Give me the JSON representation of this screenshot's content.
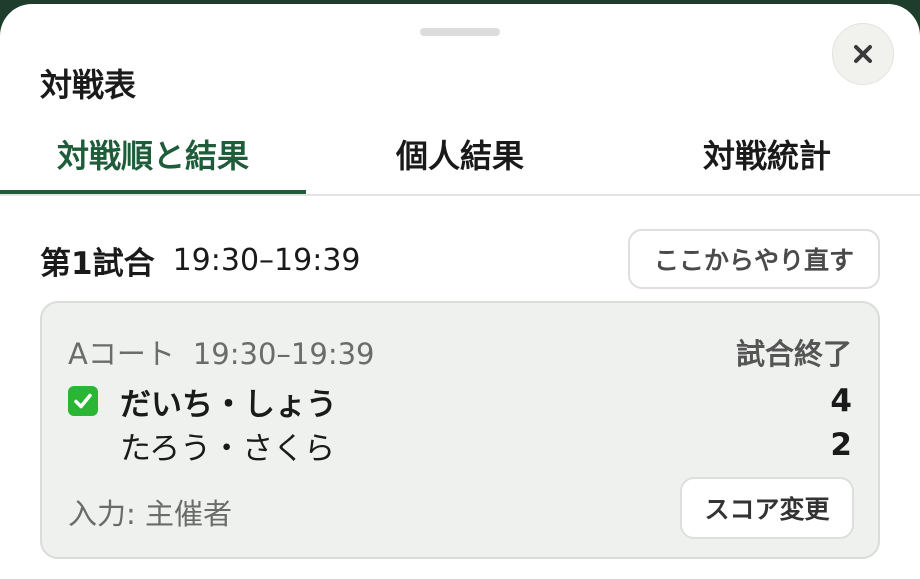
{
  "sheet": {
    "title": "対戦表",
    "close_label": "×"
  },
  "tabs": [
    {
      "label": "対戦順と結果",
      "active": true
    },
    {
      "label": "個人結果",
      "active": false
    },
    {
      "label": "対戦統計",
      "active": false
    }
  ],
  "match": {
    "number_label": "第1試合",
    "time_range": "19:30–19:39",
    "redo_label": "ここからやり直す",
    "card": {
      "court": "Aコート",
      "time_range": "19:30–19:39",
      "status": "試合終了",
      "teams": [
        {
          "name": "だいち・しょう",
          "score": "4",
          "winner": true
        },
        {
          "name": "たろう・さくら",
          "score": "2",
          "winner": false
        }
      ],
      "input_by": "入力: 主催者",
      "edit_score_label": "スコア変更"
    }
  },
  "colors": {
    "accent": "#1e5c3a",
    "winner_check": "#2bb534",
    "card_bg": "#eef1ee"
  }
}
